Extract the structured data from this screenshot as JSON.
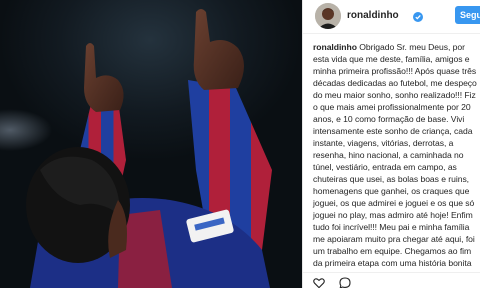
{
  "post": {
    "username": "ronaldinho",
    "follow_label": "Segu",
    "caption": {
      "username": "ronaldinho",
      "text": " Obrigado Sr. meu Deus, por\nesta vida que me deste, família, amigos e\nminha primeira profissão!!! Após quase três\ndécadas dedicadas ao futebol, me despeço\ndo meu maior sonho, sonho realizado!!! Fiz\no que mais amei profissionalmente por 20\nanos, e 10 como formação de base. Vivi\nintensamente este sonho de criança, cada\ninstante, viagens, vitórias, derrotas, a\nresenha, hino nacional, a caminhada no\ntúnel, vestiário, entrada em campo, as\nchuteiras que usei, as bolas boas e ruins,\nhomenagens que ganhei, os craques que\njoguei, os que admirei e joguei e os que só\njoguei no play, mas admiro até hoje! Enfim\ntudo foi incrível!!! Meu pai e minha família\nme apoiaram muito pra chegar até aqui, foi\num trabalho em equipe. Chegamos ao fim\nda primeira etapa com uma história bonita\npra contar."
    }
  },
  "icons": {
    "verified": "verified-badge-icon",
    "like": "heart-icon",
    "comment": "comment-icon"
  },
  "colors": {
    "follow_button": "#3897f0",
    "shirt_blue": "#1f3fa0",
    "shirt_red": "#b0203a"
  }
}
